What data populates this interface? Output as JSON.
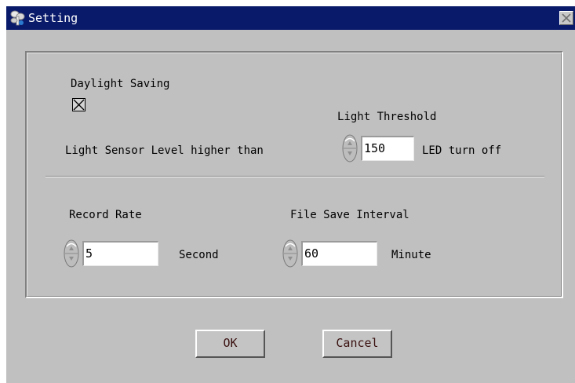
{
  "window": {
    "title": "Setting",
    "title_icon": "settings-app-icon",
    "close_icon": "close-icon",
    "titlebar_color": "#0a1a6a",
    "background_color": "#c0c0c0"
  },
  "daylight": {
    "label": "Daylight Saving",
    "checked": true
  },
  "light": {
    "threshold_label": "Light Threshold",
    "prefix_label": "Light Sensor Level higher than",
    "value": "150",
    "suffix_label": "LED turn off"
  },
  "record": {
    "label": "Record Rate",
    "value": "5",
    "unit": "Second"
  },
  "file_save": {
    "label": "File Save Interval",
    "value": "60",
    "unit": "Minute"
  },
  "buttons": {
    "ok": "OK",
    "cancel": "Cancel"
  }
}
